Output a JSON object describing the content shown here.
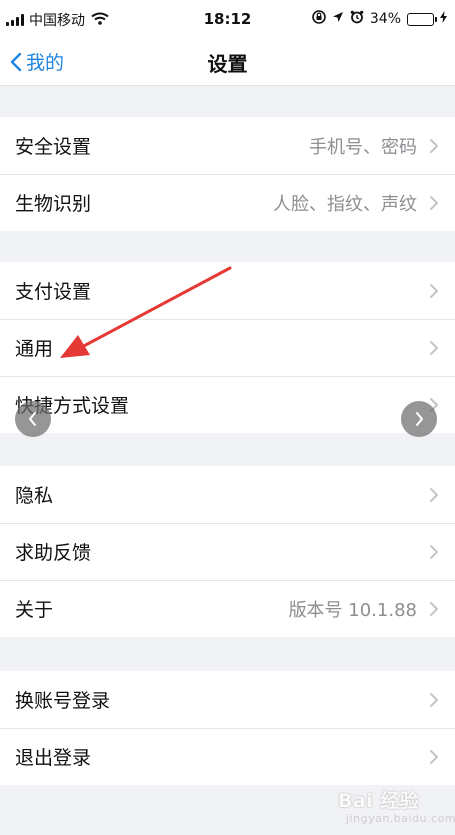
{
  "status_bar": {
    "carrier": "中国移动",
    "time": "18:12",
    "battery_percent": "34%",
    "battery_level": 0.34,
    "icons": [
      "signal-icon",
      "wifi-icon",
      "orientation-lock-icon",
      "location-icon",
      "alarm-icon",
      "battery-icon",
      "charging-icon"
    ]
  },
  "nav": {
    "back_label": "我的",
    "title": "设置"
  },
  "groups": [
    {
      "rows": [
        {
          "label": "安全设置",
          "value": "手机号、密码"
        },
        {
          "label": "生物识别",
          "value": "人脸、指纹、声纹"
        }
      ]
    },
    {
      "rows": [
        {
          "label": "支付设置",
          "value": ""
        },
        {
          "label": "通用",
          "value": ""
        },
        {
          "label": "快捷方式设置",
          "value": ""
        }
      ]
    },
    {
      "rows": [
        {
          "label": "隐私",
          "value": ""
        },
        {
          "label": "求助反馈",
          "value": ""
        },
        {
          "label": "关于",
          "value": "版本号 10.1.88"
        }
      ]
    },
    {
      "rows": [
        {
          "label": "换账号登录",
          "value": ""
        },
        {
          "label": "退出登录",
          "value": ""
        }
      ]
    }
  ],
  "annotation": {
    "color": "#e53935"
  },
  "watermark": {
    "main": "Bai 经验",
    "sub": "jingyan.baidu.com"
  },
  "colors": {
    "accent": "#1f86e0",
    "background": "#f1f2f5",
    "secondary_text": "#8e8e93"
  }
}
